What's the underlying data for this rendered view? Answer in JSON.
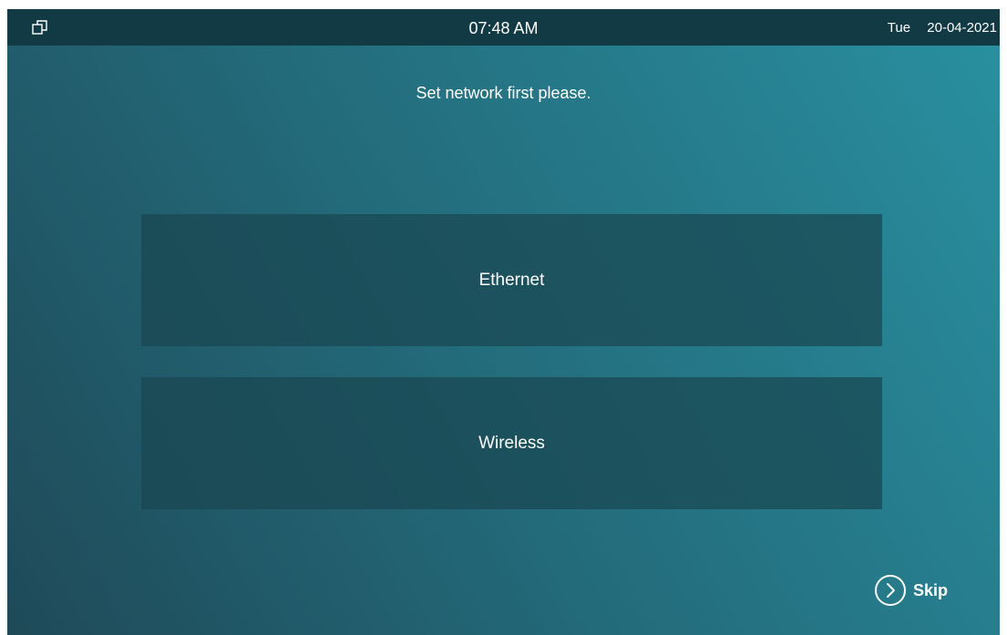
{
  "status_bar": {
    "icon": "windows-switch-icon",
    "time": "07:48 AM",
    "weekday": "Tue",
    "date": "20-04-2021"
  },
  "prompt": "Set network first please.",
  "options": [
    {
      "label": "Ethernet"
    },
    {
      "label": "Wireless"
    }
  ],
  "skip": {
    "icon": "chevron-right-circle-icon",
    "label": "Skip"
  },
  "colors": {
    "status_bar_bg": "#123a44",
    "background_dark": "#1f4a58",
    "background_light": "#2990a0",
    "option_bg": "#1c4b55",
    "text": "#ffffff"
  }
}
